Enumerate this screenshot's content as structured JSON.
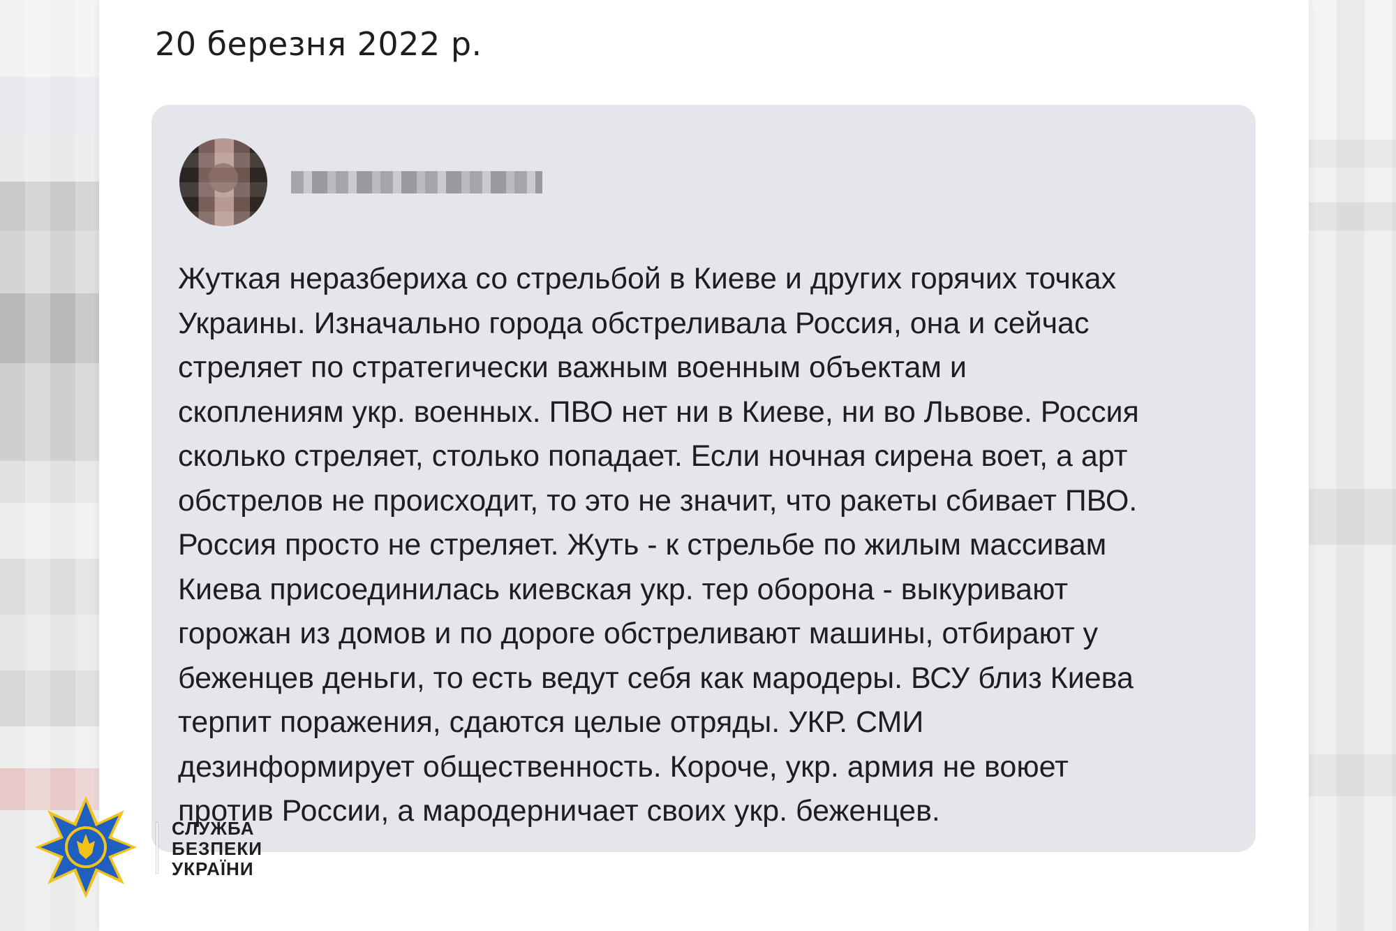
{
  "page": {
    "date": "20 березня 2022 р."
  },
  "post": {
    "author_name": "",
    "text": "Жуткая неразбериха со стрельбой в Киеве и других горячих точках\nУкраины. Изначально города обстреливала Россия, она и сейчас\nстреляет по стратегически важным военным объектам и\nскоплениям укр. военных. ПВО нет ни в Киеве, ни во Львове. Россия\nсколько стреляет, столько попадает. Если ночная сирена воет, а арт\nобстрелов не происходит, то это не значит, что ракеты сбивает ПВО.\nРоссия просто не стреляет. Жуть - к стрельбе по жилым массивам\nКиева присоединилась киевская укр. тер оборона - выкуривают\nгорожан из домов и по дороге обстреливают машины, отбирают у\nбеженцев деньги, то есть ведут себя как мародеры. ВСУ близ Киева\nтерпит поражения, сдаются целые отряды. УКР. СМИ\nдезинформирует общественность. Короче, укр. армия не воюет\nпротив России, а мародерничает своих укр. беженцев."
  },
  "watermark": {
    "line1": "СЛУЖБА",
    "line2": "БЕЗПЕКИ",
    "line3": "УКРАЇНИ",
    "logo_icon": "sbu-shield-cross-icon"
  },
  "colors": {
    "bubble_bg": "#e4e6eb",
    "text": "#1c1e21",
    "logo_blue": "#1f5fbf",
    "logo_gold": "#f2c21b"
  }
}
